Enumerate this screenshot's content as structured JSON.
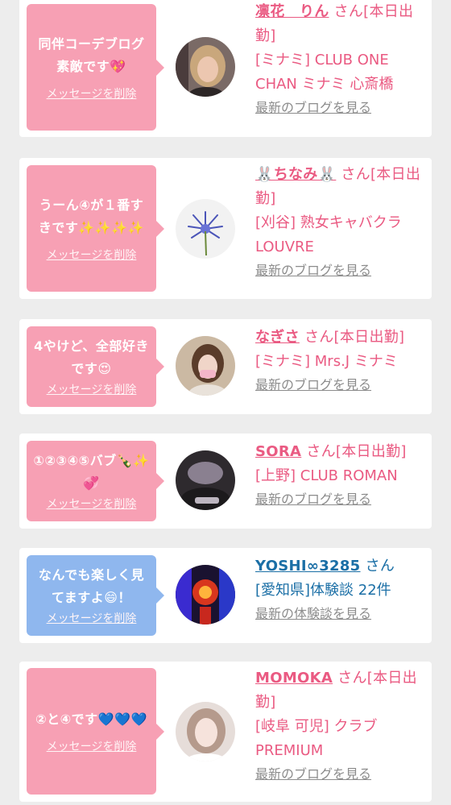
{
  "cards": [
    {
      "message": "同伴コーデブログ素敵です💖",
      "delete_label": "メッセージを削除",
      "name": "凛花　りん",
      "suffix": "さん[本日出勤]",
      "store": "[ミナミ] CLUB ONE CHAN ミナミ 心斎橋",
      "link_label": "最新のブログを見る",
      "avatar": "woman-portrait"
    },
    {
      "message": "うーん④が１番すきです✨✨✨✨",
      "delete_label": "メッセージを削除",
      "name": "🐰ちなみ🐰",
      "suffix": "さん[本日出勤]",
      "store": "[刈谷] 熟女キャバクラ LOUVRE",
      "link_label": "最新のブログを見る",
      "avatar": "flower"
    },
    {
      "message": "4やけど、全部好きです😍",
      "delete_label": "メッセージを削除",
      "name": "なぎさ",
      "suffix": "さん[本日出勤]",
      "store": "[ミナミ] Mrs.J ミナミ",
      "link_label": "最新のブログを見る",
      "avatar": "woman-mask"
    },
    {
      "message": "①②③④⑤バブ🍾✨💞",
      "delete_label": "メッセージを削除",
      "name": "SORA",
      "suffix": "さん[本日出勤]",
      "store": "[上野] CLUB ROMAN",
      "link_label": "最新のブログを見る",
      "avatar": "dark-photo"
    },
    {
      "message": "なんでも楽しく見てますよ😄！",
      "delete_label": "メッセージを削除",
      "name": "YOSHI∞3285",
      "suffix": "さん",
      "store": "[愛知県]体験談 22件",
      "link_label": "最新の体験談を見る",
      "avatar": "neon-art"
    },
    {
      "message": "②と④です💙💙💙",
      "delete_label": "メッセージを削除",
      "name": "MOMOKA",
      "suffix": "さん[本日出勤]",
      "store": "[岐阜 可児] クラブ PREMIUM",
      "link_label": "最新のブログを見る",
      "avatar": "woman-portrait"
    }
  ],
  "colors": {
    "pink_bubble": "#f7a0b4",
    "blue_bubble": "#8fb7ee",
    "name_pink": "#ea5a82",
    "name_blue": "#1b6fa6",
    "link_gray": "#8c8c8c"
  }
}
